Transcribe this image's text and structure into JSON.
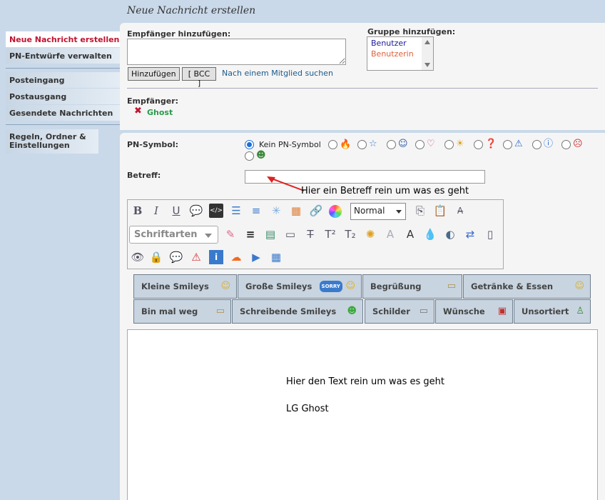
{
  "page_title": "Neue Nachricht erstellen",
  "sidebar": {
    "items": [
      {
        "label": "Neue Nachricht erstellen"
      },
      {
        "label": "PN-Entwürfe verwalten"
      },
      {
        "label": "Posteingang"
      },
      {
        "label": "Postausgang"
      },
      {
        "label": "Gesendete Nachrichten"
      },
      {
        "label": "Regeln, Ordner & Einstellungen"
      }
    ]
  },
  "recipients": {
    "add_label": "Empfänger hinzufügen:",
    "add_button": "Hinzufügen",
    "bcc_button": "[ BCC ]",
    "search_link": "Nach einem Mitglied suchen",
    "group_label": "Gruppe hinzufügen:",
    "groups": [
      "Benutzer",
      "Benutzerin"
    ],
    "list_label": "Empfänger:",
    "list": [
      "Ghost"
    ]
  },
  "pm_symbol": {
    "label": "PN-Symbol:",
    "none_label": "Kein PN-Symbol",
    "symbols": [
      "flame-icon",
      "star-icon",
      "smiley-icon",
      "heart-icon",
      "sun-icon",
      "question-icon",
      "warning-icon",
      "info-icon",
      "angry-icon",
      "grin-icon"
    ]
  },
  "subject": {
    "label": "Betreff:",
    "value": ""
  },
  "annotations": {
    "subject_hint": "Hier ein Betreff rein um was es geht"
  },
  "toolbar": {
    "format_value": "Normal",
    "font_label": "Schriftarten"
  },
  "smiley_tabs": {
    "row1": [
      "Kleine Smileys",
      "Große Smileys",
      "Begrüßung",
      "Getränke & Essen"
    ],
    "row2": [
      "Bin mal weg",
      "Schreibende Smileys",
      "Schilder",
      "Wünsche",
      "Unsortiert"
    ],
    "icon_text": {
      "sorry": "SORRY"
    }
  },
  "message": {
    "line1": "Hier den Text rein um was es geht",
    "line2": "LG Ghost"
  },
  "colors": {
    "accent_red": "#c4122f",
    "link_blue": "#1a5a8c",
    "recipient_green": "#2a9a4a",
    "group_benutzer": "#1a1a9a",
    "group_benutzerin": "#e0603a"
  }
}
